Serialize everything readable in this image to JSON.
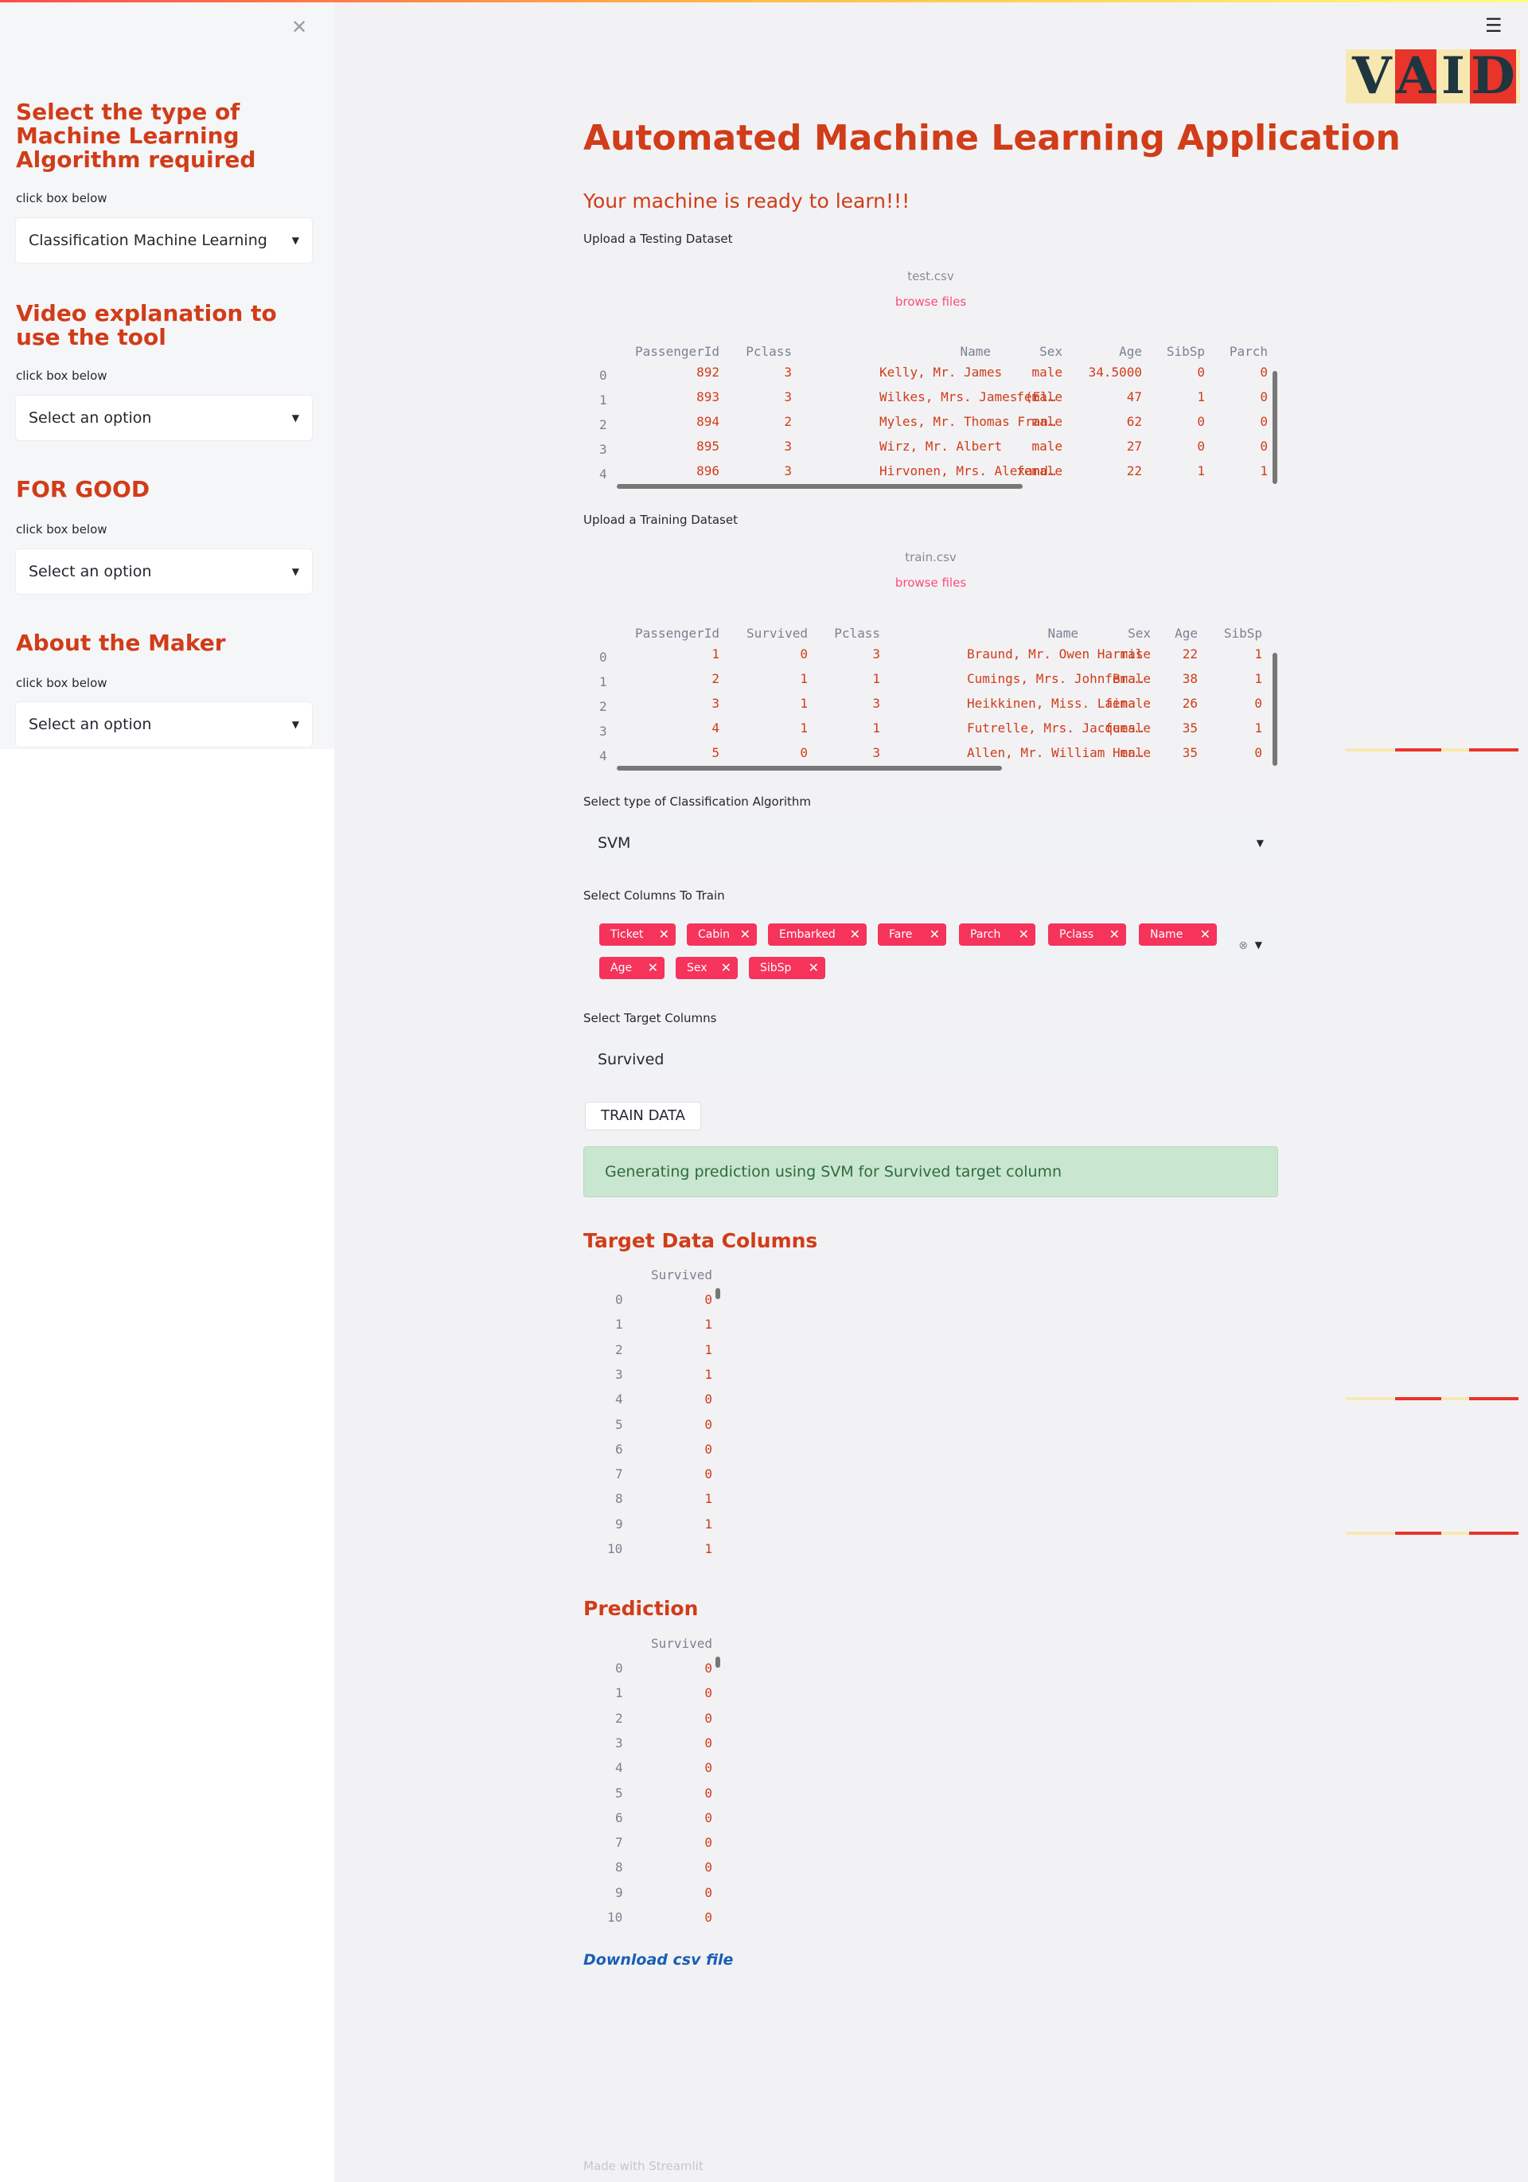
{
  "sidebar": {
    "close_icon": "close-icon",
    "sections": [
      {
        "title": "Select the type of Machine Learning Algorithm required",
        "hint": "click box below",
        "selected": "Classification Machine Learning"
      },
      {
        "title": "Video explanation to use the tool",
        "hint": "click box below",
        "selected": "Select an option"
      },
      {
        "title": "FOR GOOD",
        "hint": "click box below",
        "selected": "Select an option"
      },
      {
        "title": "About the Maker",
        "hint": "click box below",
        "selected": "Select an option"
      }
    ]
  },
  "header": {
    "menu_icon": "hamburger-menu-icon",
    "logo_text": [
      "V",
      "A",
      "I",
      "D"
    ]
  },
  "main": {
    "title": "Automated Machine Learning Application",
    "subtitle": "Your machine is ready to learn!!!",
    "testing_upload": {
      "label": "Upload a Testing Dataset",
      "filename": "test.csv",
      "browse": "browse files"
    },
    "test_table": {
      "columns": [
        "PassengerId",
        "Pclass",
        "Name",
        "Sex",
        "Age",
        "SibSp",
        "Parch"
      ],
      "index": [
        "0",
        "1",
        "2",
        "3",
        "4"
      ],
      "rows": [
        [
          "892",
          "3",
          "Kelly, Mr. James",
          "male",
          "34.5000",
          "0",
          "0"
        ],
        [
          "893",
          "3",
          "Wilkes, Mrs. James (El…",
          "female",
          "47",
          "1",
          "0"
        ],
        [
          "894",
          "2",
          "Myles, Mr. Thomas Fran…",
          "male",
          "62",
          "0",
          "0"
        ],
        [
          "895",
          "3",
          "Wirz, Mr. Albert",
          "male",
          "27",
          "0",
          "0"
        ],
        [
          "896",
          "3",
          "Hirvonen, Mrs. Alexand…",
          "female",
          "22",
          "1",
          "1"
        ]
      ]
    },
    "training_upload": {
      "label": "Upload a Training Dataset",
      "filename": "train.csv",
      "browse": "browse files"
    },
    "train_table": {
      "columns": [
        "PassengerId",
        "Survived",
        "Pclass",
        "Name",
        "Sex",
        "Age",
        "SibSp"
      ],
      "index": [
        "0",
        "1",
        "2",
        "3",
        "4"
      ],
      "rows": [
        [
          "1",
          "0",
          "3",
          "Braund, Mr. Owen Harris",
          "male",
          "22",
          "1"
        ],
        [
          "2",
          "1",
          "1",
          "Cumings, Mrs. John Bra…",
          "female",
          "38",
          "1"
        ],
        [
          "3",
          "1",
          "3",
          "Heikkinen, Miss. Laina",
          "female",
          "26",
          "0"
        ],
        [
          "4",
          "1",
          "1",
          "Futrelle, Mrs. Jacques…",
          "female",
          "35",
          "1"
        ],
        [
          "5",
          "0",
          "3",
          "Allen, Mr. William Hen…",
          "male",
          "35",
          "0"
        ]
      ]
    },
    "algorithm": {
      "label": "Select type of Classification Algorithm",
      "selected": "SVM"
    },
    "columns_select": {
      "label": "Select Columns To Train",
      "chips": [
        "Ticket",
        "Cabin",
        "Embarked",
        "Fare",
        "Parch",
        "Pclass",
        "Name",
        "Age",
        "Sex",
        "SibSp"
      ]
    },
    "target": {
      "label": "Select Target Columns",
      "selected": "Survived"
    },
    "train_button": "TRAIN DATA",
    "alert": "Generating prediction using SVM for Survived target column",
    "target_section": {
      "title": "Target Data Columns",
      "column": "Survived",
      "index": [
        "0",
        "1",
        "2",
        "3",
        "4",
        "5",
        "6",
        "7",
        "8",
        "9",
        "10"
      ],
      "values": [
        "0",
        "1",
        "1",
        "1",
        "0",
        "0",
        "0",
        "0",
        "1",
        "1",
        "1"
      ]
    },
    "prediction_section": {
      "title": "Prediction",
      "column": "Survived",
      "index": [
        "0",
        "1",
        "2",
        "3",
        "4",
        "5",
        "6",
        "7",
        "8",
        "9",
        "10"
      ],
      "values": [
        "0",
        "0",
        "0",
        "0",
        "0",
        "0",
        "0",
        "0",
        "0",
        "0",
        "0"
      ]
    },
    "download": "Download csv file",
    "footer": "Made with Streamlit"
  },
  "colors": {
    "accent": "#d13c19",
    "chip": "#f5335b",
    "link": "#1a5fb4",
    "success_bg": "#c8e6d0"
  }
}
